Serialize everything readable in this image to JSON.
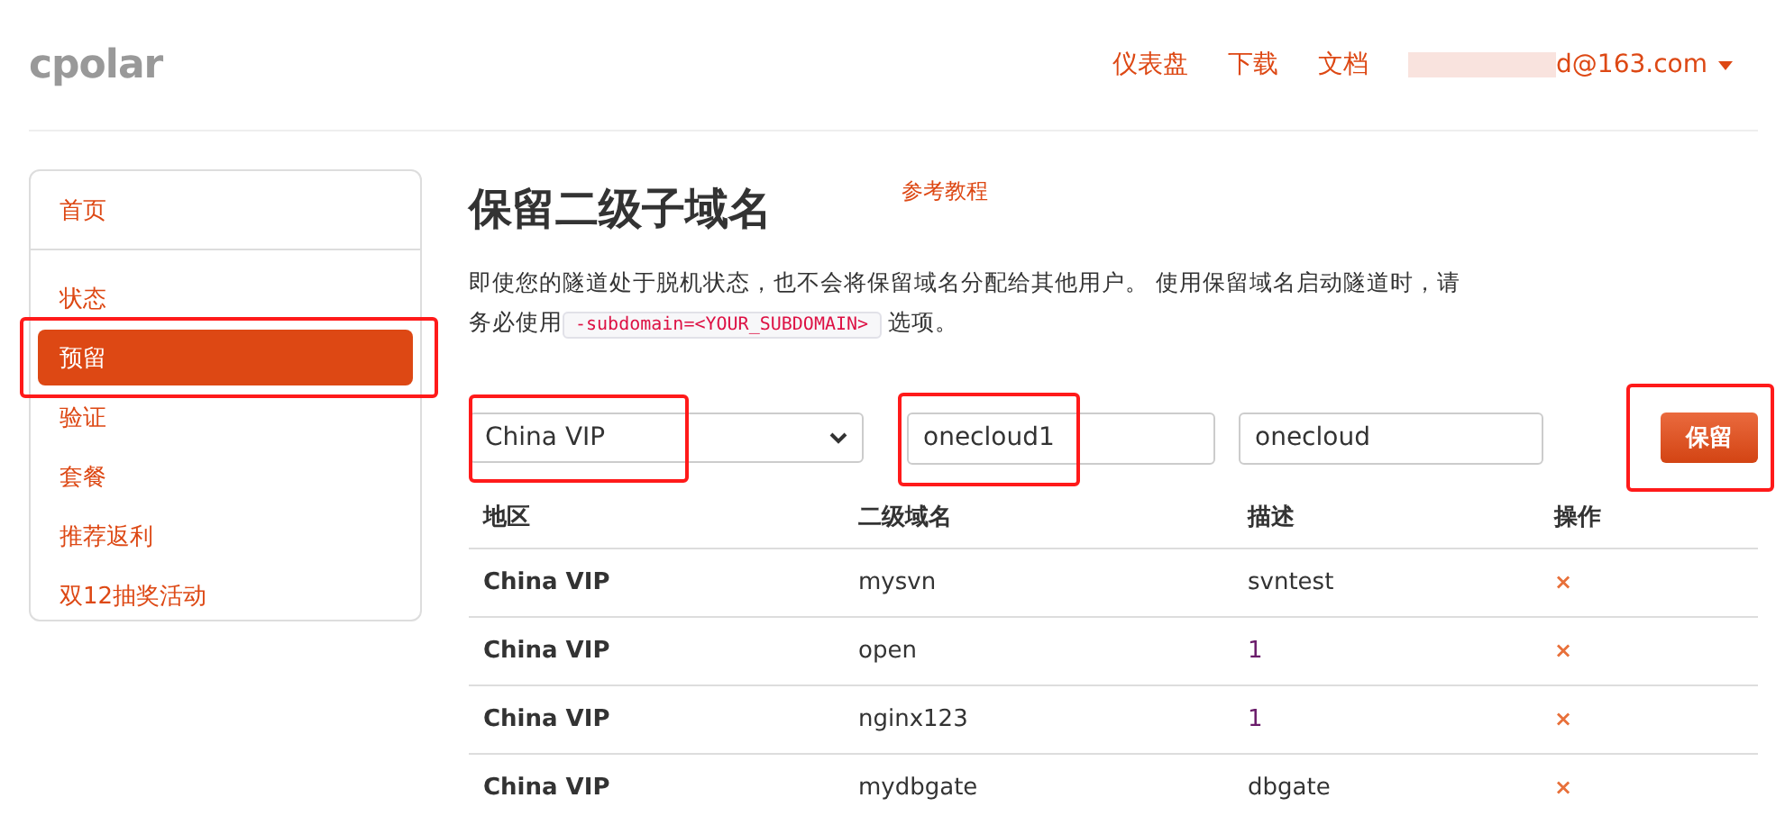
{
  "header": {
    "logo": "cpolar",
    "nav": [
      {
        "label": "仪表盘"
      },
      {
        "label": "下载"
      },
      {
        "label": "文档"
      }
    ],
    "account": {
      "email": "d@163.com"
    }
  },
  "sidebar": {
    "items": [
      {
        "label": "首页",
        "selected": false,
        "highlighted": false
      },
      {
        "label": "状态",
        "selected": false,
        "highlighted": false
      },
      {
        "label": "预留",
        "selected": true,
        "highlighted": true
      },
      {
        "label": "验证",
        "selected": false,
        "highlighted": false
      },
      {
        "label": "套餐",
        "selected": false,
        "highlighted": false
      },
      {
        "label": "推荐返利",
        "selected": false,
        "highlighted": false
      },
      {
        "label": "双12抽奖活动",
        "selected": false,
        "highlighted": false
      }
    ]
  },
  "page": {
    "title": "保留二级子域名",
    "tutorial_link": "参考教程",
    "description_before": "即使您的隧道处于脱机状态，也不会将保留域名分配给其他用户。 使用保留域名启动隧道时，请务必使用",
    "code": "-subdomain=<YOUR_SUBDOMAIN>",
    "description_after": "选项。"
  },
  "form": {
    "region": {
      "value": "China VIP",
      "highlighted": true
    },
    "subdomain": {
      "value": "onecloud1",
      "highlighted": true
    },
    "description": {
      "value": "onecloud",
      "highlighted": false
    },
    "submit": {
      "label": "保留",
      "highlighted": true
    }
  },
  "table": {
    "columns": [
      "地区",
      "二级域名",
      "描述",
      "操作"
    ],
    "rows": [
      {
        "region": "China VIP",
        "subdomain": "mysvn",
        "description": "svntest",
        "description_linked": false,
        "delete": "×"
      },
      {
        "region": "China VIP",
        "subdomain": "open",
        "description": "1",
        "description_linked": true,
        "delete": "×"
      },
      {
        "region": "China VIP",
        "subdomain": "nginx123",
        "description": "1",
        "description_linked": true,
        "delete": "×"
      },
      {
        "region": "China VIP",
        "subdomain": "mydbgate",
        "description": "dbgate",
        "description_linked": false,
        "delete": "×"
      }
    ]
  }
}
